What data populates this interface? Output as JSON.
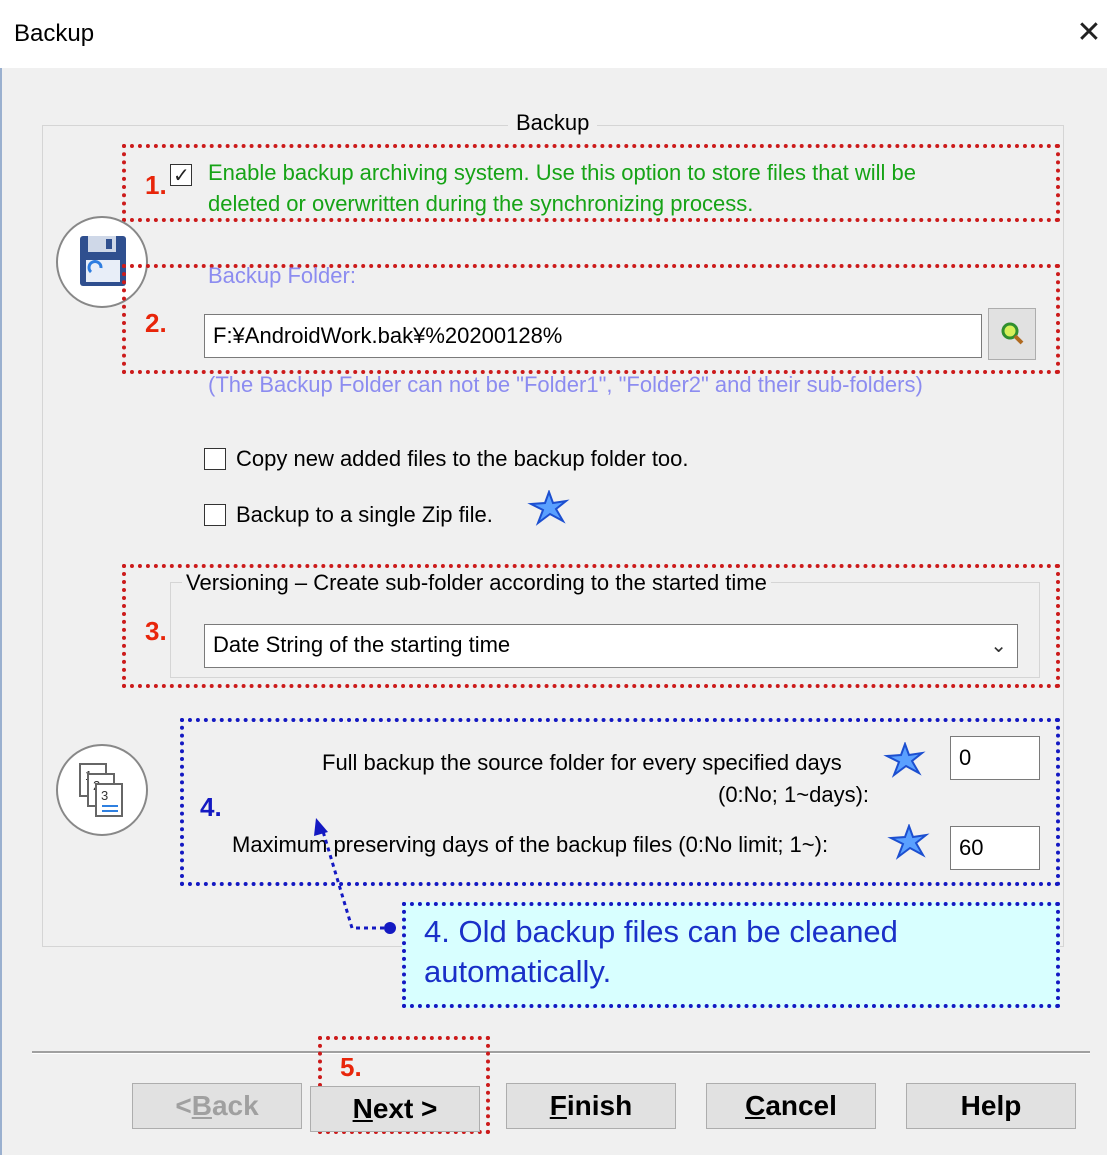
{
  "window": {
    "title": "Backup",
    "close_glyph": "✕"
  },
  "group": {
    "title": "Backup"
  },
  "annotations": {
    "n1": "1.",
    "n2": "2.",
    "n3": "3.",
    "n4": "4.",
    "n5": "5."
  },
  "enable_backup": {
    "checked": true,
    "line1": "Enable backup archiving system. Use this option to store files that will be",
    "line2": "deleted or overwritten during the synchronizing process."
  },
  "backup_folder": {
    "label": "Backup Folder:",
    "value": "F:¥AndroidWork.bak¥%20200128%",
    "note": "(The Backup Folder can not be \"Folder1\", \"Folder2\" and their sub-folders)"
  },
  "options": {
    "copy_new": "Copy new added files to the backup folder too.",
    "single_zip": "Backup to a single Zip file."
  },
  "versioning": {
    "legend": "Versioning – Create sub-folder according to the started time",
    "selected": "Date String of the starting time"
  },
  "retention": {
    "full_backup_line1": "Full backup the source folder for every specified days",
    "full_backup_line2": "(0:No; 1~days):",
    "full_backup_value": "0",
    "max_days_label": "Maximum preserving days of the backup files (0:No limit; 1~):",
    "max_days_value": "60"
  },
  "callout": {
    "text": "4. Old backup files can be cleaned automatically."
  },
  "buttons": {
    "back": {
      "prefix": "<",
      "accel": "B",
      "rest": "ack"
    },
    "next": {
      "accel": "N",
      "rest": "ext >"
    },
    "finish": {
      "accel": "F",
      "rest": "inish"
    },
    "cancel": {
      "accel": "C",
      "rest": "ancel"
    },
    "help": "Help"
  },
  "colors": {
    "annotation_red": "#cc1b1b",
    "annotation_blue": "#1419c2",
    "enable_text_green": "#16a316",
    "folder_label_purple": "#8c8cf0",
    "callout_bg": "#d8ffff"
  }
}
